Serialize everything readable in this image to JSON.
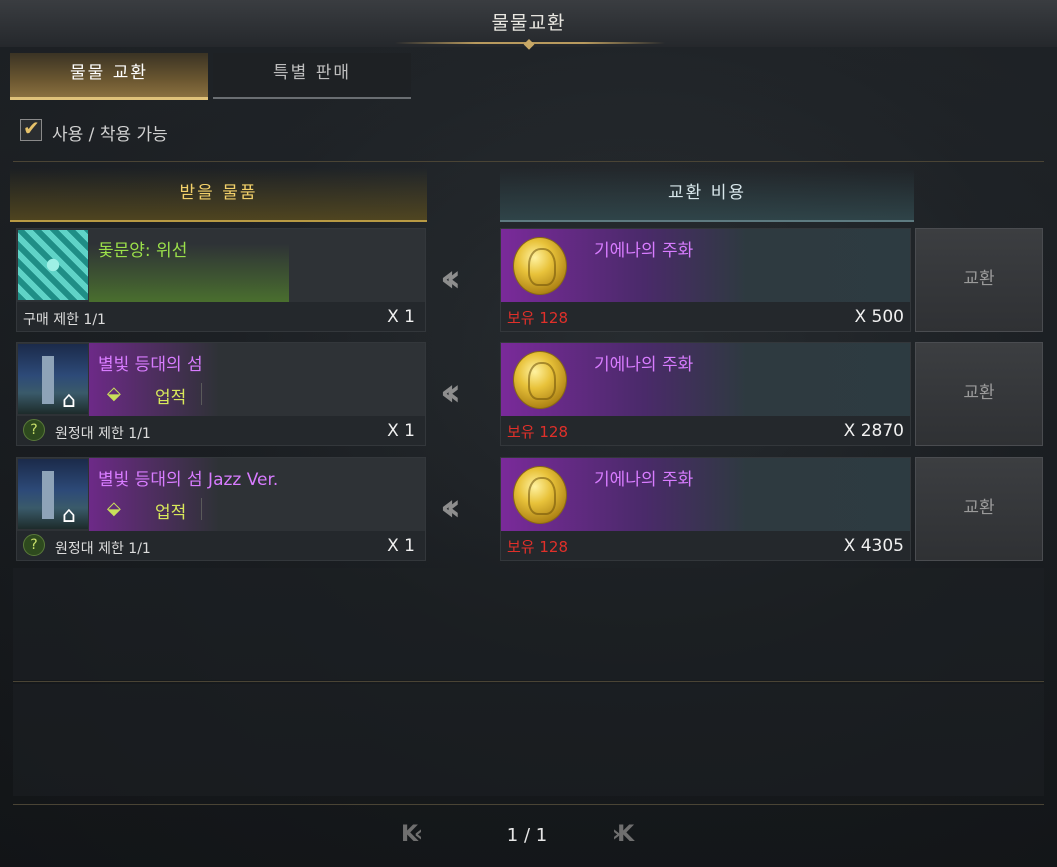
{
  "window": {
    "title": "물물교환"
  },
  "tabs": [
    {
      "label": "물물 교환",
      "active": true
    },
    {
      "label": "특별 판매",
      "active": false
    }
  ],
  "filter": {
    "label": "사용 / 착용 가능",
    "checked": true
  },
  "headers": {
    "receive": "받을 물품",
    "cost": "교환 비용"
  },
  "rows": [
    {
      "item_name": "돛문양: 위선",
      "item_color": "#9be04a",
      "badge": "",
      "limit": "구매 제한 1/1",
      "limit_icon": false,
      "qty": "X 1",
      "cost_name": "기에나의 주화",
      "owned": "보유 128",
      "cost_qty": "X 500",
      "button": "교환"
    },
    {
      "item_name": "별빛 등대의 섬",
      "item_color": "#d87cff",
      "badge": "업적",
      "limit": "원정대 제한 1/1",
      "limit_icon": true,
      "qty": "X 1",
      "cost_name": "기에나의 주화",
      "owned": "보유 128",
      "cost_qty": "X 2870",
      "button": "교환"
    },
    {
      "item_name": "별빛 등대의 섬 Jazz Ver.",
      "item_color": "#d87cff",
      "badge": "업적",
      "limit": "원정대 제한 1/1",
      "limit_icon": true,
      "qty": "X 1",
      "cost_name": "기에나의 주화",
      "owned": "보유 128",
      "cost_qty": "X 4305",
      "button": "교환"
    }
  ],
  "pager": {
    "text": "1 / 1",
    "first": "K‹",
    "prev": "‹",
    "next": "›",
    "last": "›K"
  },
  "icons": {
    "check": "check-icon",
    "home": "home-icon",
    "achievement": "chevron-badge-icon",
    "question": "question-icon",
    "arrow": "double-left-arrow-icon",
    "coin": "coin-icon"
  }
}
